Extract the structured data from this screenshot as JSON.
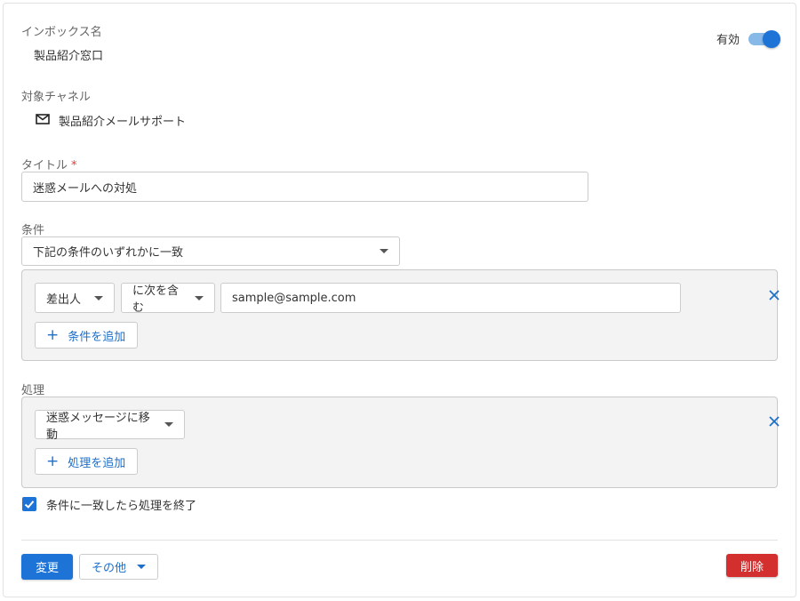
{
  "inbox": {
    "label": "インボックス名",
    "value": "製品紹介窓口"
  },
  "status": {
    "label": "有効",
    "enabled": true
  },
  "channel": {
    "label": "対象チャネル",
    "icon": "mail-icon",
    "value": "製品紹介メールサポート"
  },
  "title": {
    "label": "タイトル",
    "required_mark": "*",
    "value": "迷惑メールへの対処"
  },
  "conditions": {
    "label": "条件",
    "match_mode": "下記の条件のいずれかに一致",
    "rules": [
      {
        "field": "差出人",
        "operator": "に次を含む",
        "value": "sample@sample.com"
      }
    ],
    "add_label": "条件を追加"
  },
  "actions": {
    "label": "処理",
    "items": [
      {
        "action": "迷惑メッセージに移動"
      }
    ],
    "add_label": "処理を追加"
  },
  "stop_processing": {
    "label": "条件に一致したら処理を終了",
    "checked": true
  },
  "footer": {
    "save_label": "変更",
    "more_label": "その他",
    "delete_label": "削除"
  },
  "colors": {
    "primary": "#1e74d6",
    "danger": "#d32f2f",
    "panel": "#f3f3f3"
  }
}
